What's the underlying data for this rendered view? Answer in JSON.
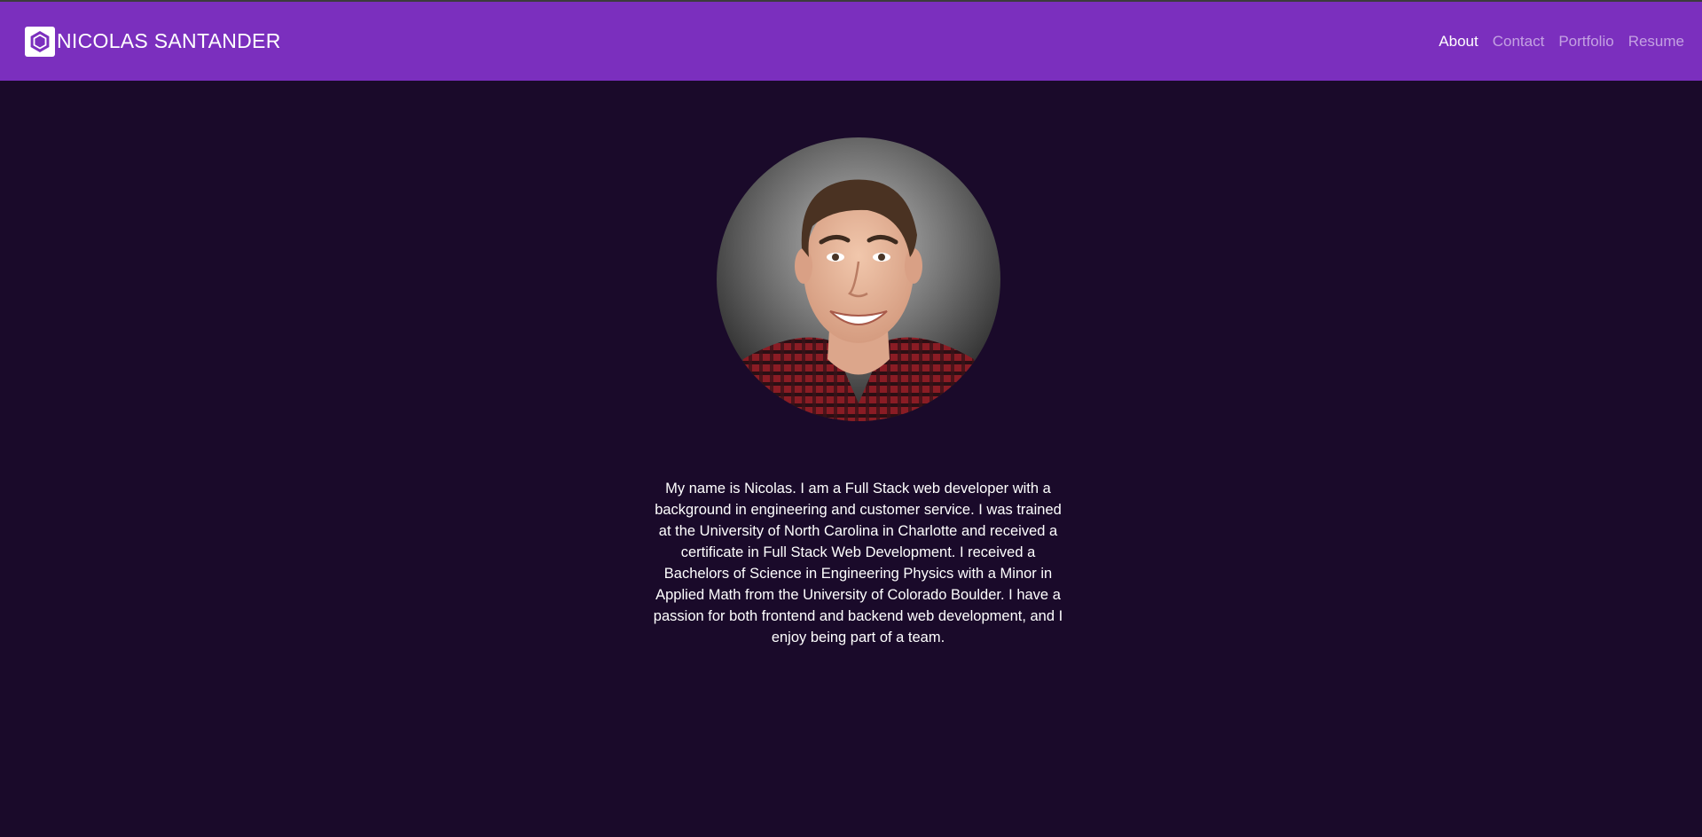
{
  "header": {
    "brand_name": "NICOLAS SANTANDER",
    "logo_icon": "hexagon-logo-icon",
    "background_color": "#7b2fbe"
  },
  "nav": {
    "items": [
      {
        "label": "About",
        "active": true
      },
      {
        "label": "Contact",
        "active": false
      },
      {
        "label": "Portfolio",
        "active": false
      },
      {
        "label": "Resume",
        "active": false
      }
    ]
  },
  "about": {
    "bio": "My name is Nicolas. I am a Full Stack web developer with a background in engineering and customer service. I was trained at the University of North Carolina in Charlotte and received a certificate in Full Stack Web Development. I received a Bachelors of Science in Engineering Physics with a Minor in Applied Math from the University of Colorado Boulder. I have a passion for both frontend and backend web development, and I enjoy being part of a team."
  },
  "colors": {
    "page_background": "#1a0a2a",
    "accent": "#7b2fbe"
  }
}
